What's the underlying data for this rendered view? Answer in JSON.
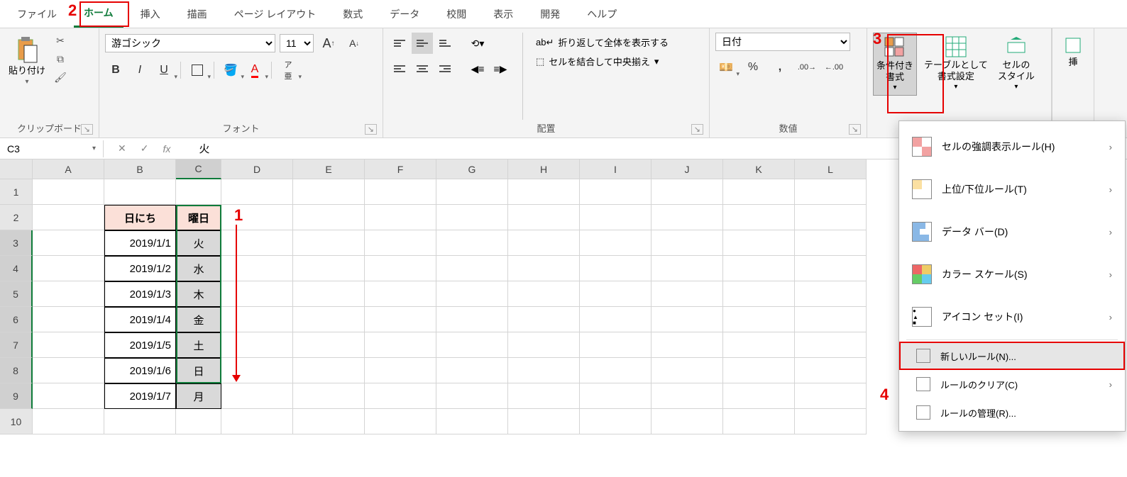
{
  "tabs": [
    "ファイル",
    "ホーム",
    "挿入",
    "描画",
    "ページ レイアウト",
    "数式",
    "データ",
    "校閲",
    "表示",
    "開発",
    "ヘルプ"
  ],
  "activeTab": 1,
  "groups": {
    "clipboard": {
      "label": "クリップボード",
      "paste": "貼り付け"
    },
    "font": {
      "label": "フォント",
      "name": "游ゴシック",
      "size": "11"
    },
    "align": {
      "label": "配置",
      "wrap": "折り返して全体を表示する",
      "merge": "セルを結合して中央揃え"
    },
    "number": {
      "label": "数値",
      "format": "日付"
    },
    "styles": {
      "cond": "条件付き\n書式",
      "table": "テーブルとして\n書式設定",
      "cell": "セルの\nスタイル",
      "insert": "挿"
    }
  },
  "nameBox": "C3",
  "fxValue": "火",
  "columns": [
    "A",
    "B",
    "C",
    "D",
    "E",
    "F",
    "G",
    "H",
    "I",
    "J",
    "K",
    "L"
  ],
  "rows": [
    "1",
    "2",
    "3",
    "4",
    "5",
    "6",
    "7",
    "8",
    "9",
    "10"
  ],
  "tableHeaders": {
    "date": "日にち",
    "day": "曜日"
  },
  "tableData": [
    {
      "date": "2019/1/1",
      "day": "火"
    },
    {
      "date": "2019/1/2",
      "day": "水"
    },
    {
      "date": "2019/1/3",
      "day": "木"
    },
    {
      "date": "2019/1/4",
      "day": "金"
    },
    {
      "date": "2019/1/5",
      "day": "土"
    },
    {
      "date": "2019/1/6",
      "day": "日"
    },
    {
      "date": "2019/1/7",
      "day": "月"
    }
  ],
  "cfmenu": {
    "highlight": "セルの強調表示ルール(H)",
    "toprank": "上位/下位ルール(T)",
    "databar": "データ バー(D)",
    "colorscale": "カラー スケール(S)",
    "iconset": "アイコン セット(I)",
    "newrule": "新しいルール(N)...",
    "clear": "ルールのクリア(C)",
    "manage": "ルールの管理(R)..."
  },
  "annotations": {
    "n1": "1",
    "n2": "2",
    "n3": "3",
    "n4": "4"
  }
}
